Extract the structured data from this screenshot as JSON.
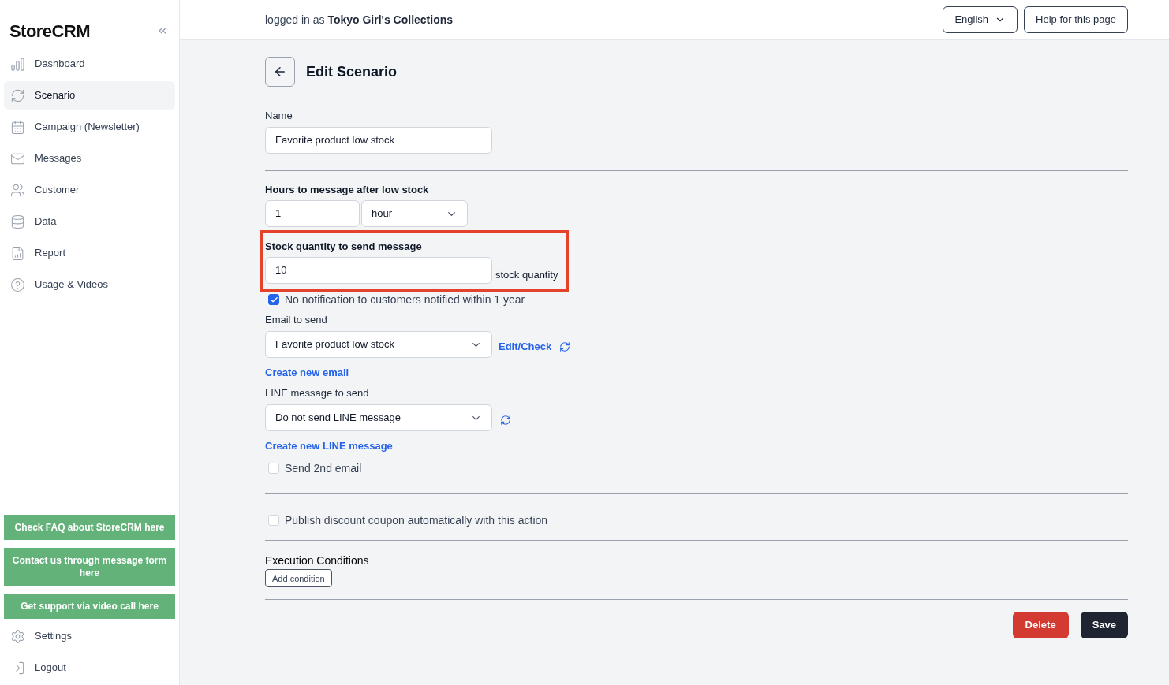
{
  "sidebar": {
    "logo": "StoreCRM",
    "items": [
      {
        "label": "Dashboard",
        "selected": false
      },
      {
        "label": "Scenario",
        "selected": true
      },
      {
        "label": "Campaign (Newsletter)",
        "selected": false
      },
      {
        "label": "Messages",
        "selected": false
      },
      {
        "label": "Customer",
        "selected": false
      },
      {
        "label": "Data",
        "selected": false
      },
      {
        "label": "Report",
        "selected": false
      },
      {
        "label": "Usage & Videos",
        "selected": false
      }
    ],
    "support_buttons": [
      "Check FAQ about StoreCRM here",
      "Contact us through message form here",
      "Get support via video call here"
    ],
    "bottom_items": [
      "Settings",
      "Logout"
    ]
  },
  "header": {
    "login_prefix": "logged in as",
    "store_name": "Tokyo Girl's Collections",
    "language": "English",
    "help": "Help for this page"
  },
  "page": {
    "title": "Edit Scenario",
    "name": {
      "label": "Name",
      "value": "Favorite product low stock"
    },
    "hours": {
      "label": "Hours to message after low stock",
      "value": "1",
      "unit": "hour"
    },
    "stock": {
      "label": "Stock quantity to send message",
      "value": "10",
      "suffix": "stock quantity",
      "highlighted": true
    },
    "no_notification": {
      "label": "No notification to customers notified within 1 year",
      "checked": true
    },
    "email": {
      "label": "Email to send",
      "value": "Favorite product low stock",
      "edit_link": "Edit/Check",
      "create_link": "Create new email"
    },
    "line": {
      "label": "LINE message to send",
      "value": "Do not send LINE message",
      "create_link": "Create new LINE message"
    },
    "second_email": {
      "label": "Send 2nd email",
      "checked": false
    },
    "coupon": {
      "label": "Publish discount coupon automatically with this action",
      "checked": false
    },
    "conditions": {
      "title": "Execution Conditions",
      "add_button": "Add condition"
    },
    "actions": {
      "delete": "Delete",
      "save": "Save"
    }
  }
}
